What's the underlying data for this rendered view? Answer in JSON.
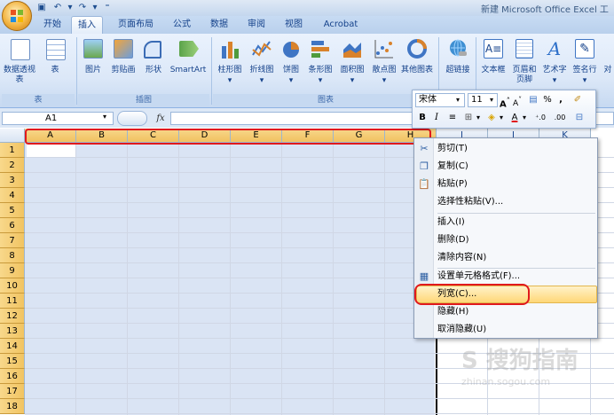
{
  "window": {
    "title": "新建 Microsoft Office Excel 工"
  },
  "quick_access": {
    "save_icon": "save-icon",
    "undo_icon": "undo-icon",
    "redo_icon": "redo-icon",
    "customize_icon": "customize-icon"
  },
  "tabs": [
    "开始",
    "插入",
    "页面布局",
    "公式",
    "数据",
    "审阅",
    "视图",
    "Acrobat"
  ],
  "active_tab": "插入",
  "ribbon": {
    "groups": [
      {
        "label": "表",
        "items": [
          "数据透视表",
          "表"
        ]
      },
      {
        "label": "插图",
        "items": [
          "图片",
          "剪贴画",
          "形状",
          "SmartArt"
        ]
      },
      {
        "label": "图表",
        "items": [
          "柱形图",
          "折线图",
          "饼图",
          "条形图",
          "面积图",
          "散点图",
          "其他图表"
        ]
      },
      {
        "label": "",
        "items": [
          "超链接"
        ]
      },
      {
        "label": "",
        "items": [
          "文本框",
          "页眉和页脚",
          "艺术字",
          "签名行",
          "对"
        ]
      }
    ]
  },
  "formula_bar": {
    "name_box": "A1",
    "fx_label": "fx",
    "value": ""
  },
  "columns": [
    "A",
    "B",
    "C",
    "D",
    "E",
    "F",
    "G",
    "H",
    "I",
    "J",
    "K"
  ],
  "rows": [
    "1",
    "2",
    "3",
    "4",
    "5",
    "6",
    "7",
    "8",
    "9",
    "10",
    "11",
    "12",
    "13",
    "14",
    "15",
    "16",
    "17",
    "18"
  ],
  "mini_toolbar": {
    "font": "宋体",
    "size": "11",
    "percent": "%",
    "comma": ",",
    "bold": "B",
    "italic": "I"
  },
  "context_menu": {
    "items": [
      {
        "label": "剪切(T)",
        "icon": "scissors-icon"
      },
      {
        "label": "复制(C)",
        "icon": "copy-icon"
      },
      {
        "label": "粘贴(P)",
        "icon": "paste-icon"
      },
      {
        "label": "选择性粘贴(V)...",
        "icon": ""
      },
      {
        "label": "插入(I)",
        "icon": ""
      },
      {
        "label": "删除(D)",
        "icon": ""
      },
      {
        "label": "清除内容(N)",
        "icon": ""
      },
      {
        "label": "设置单元格格式(F)...",
        "icon": "format-cells-icon"
      },
      {
        "label": "列宽(C)...",
        "icon": "",
        "highlighted": true
      },
      {
        "label": "隐藏(H)",
        "icon": ""
      },
      {
        "label": "取消隐藏(U)",
        "icon": ""
      }
    ]
  },
  "watermark": {
    "text": "S 搜狗指南",
    "sub": "zhinan.sogou.com"
  },
  "colors": {
    "highlight": "#e0191d",
    "ribbon": "#dce8f8",
    "selection": "#bccdeb"
  }
}
